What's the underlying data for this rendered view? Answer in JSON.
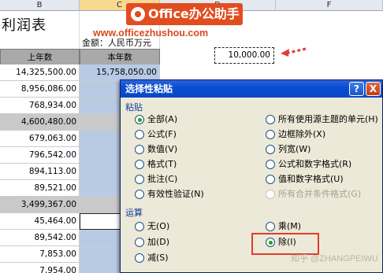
{
  "columns": [
    {
      "label": "B",
      "selected": false
    },
    {
      "label": "C",
      "selected": true
    },
    {
      "label": "D",
      "selected": false
    },
    {
      "label": "F",
      "selected": false
    }
  ],
  "sheet": {
    "title": "利润表",
    "amount_label": "金额：人民币万元",
    "header_prev": "上年数",
    "header_curr": "本年数",
    "clipboard_value": "10,000.00",
    "rows": [
      {
        "prev": "14,325,500.00",
        "curr": "15,758,050.00",
        "prev_style": "white",
        "curr_style": "blue"
      },
      {
        "prev": "8,956,086.00",
        "curr": "9,8",
        "prev_style": "white",
        "curr_style": "blue"
      },
      {
        "prev": "768,934.00",
        "curr": "8",
        "prev_style": "white",
        "curr_style": "blue"
      },
      {
        "prev": "4,600,480.00",
        "curr": "5,0",
        "prev_style": "gray",
        "curr_style": "gray"
      },
      {
        "prev": "679,063.00",
        "curr": "7",
        "prev_style": "white",
        "curr_style": "blue"
      },
      {
        "prev": "796,542.00",
        "curr": "8",
        "prev_style": "white",
        "curr_style": "blue"
      },
      {
        "prev": "894,113.00",
        "curr": "9",
        "prev_style": "white",
        "curr_style": "blue"
      },
      {
        "prev": "89,521.00",
        "curr": "",
        "prev_style": "white",
        "curr_style": "blue"
      },
      {
        "prev": "3,499,367.00",
        "curr": "3,8",
        "prev_style": "gray",
        "curr_style": "gray"
      },
      {
        "prev": "45,464.00",
        "curr": "",
        "prev_style": "white",
        "curr_style": "emptybox"
      },
      {
        "prev": "89,542.00",
        "curr": "",
        "prev_style": "white",
        "curr_style": "blue"
      },
      {
        "prev": "7,853.00",
        "curr": "",
        "prev_style": "white",
        "curr_style": "blue"
      },
      {
        "prev": "7,954.00",
        "curr": "",
        "prev_style": "white",
        "curr_style": "blue"
      }
    ]
  },
  "overlay": {
    "banner": "Office办公助手",
    "url": "www.officezhushou.com"
  },
  "dialog": {
    "title": "选择性粘贴",
    "help_label": "?",
    "close_label": "X",
    "paste_section": "粘贴",
    "paste_left": [
      {
        "label": "全部(A)",
        "checked": true,
        "disabled": false
      },
      {
        "label": "公式(F)",
        "checked": false,
        "disabled": false
      },
      {
        "label": "数值(V)",
        "checked": false,
        "disabled": false
      },
      {
        "label": "格式(T)",
        "checked": false,
        "disabled": false
      },
      {
        "label": "批注(C)",
        "checked": false,
        "disabled": false
      },
      {
        "label": "有效性验证(N)",
        "checked": false,
        "disabled": false
      }
    ],
    "paste_right": [
      {
        "label": "所有使用源主题的单元(H)",
        "checked": false,
        "disabled": false
      },
      {
        "label": "边框除外(X)",
        "checked": false,
        "disabled": false
      },
      {
        "label": "列宽(W)",
        "checked": false,
        "disabled": false
      },
      {
        "label": "公式和数字格式(R)",
        "checked": false,
        "disabled": false
      },
      {
        "label": "值和数字格式(U)",
        "checked": false,
        "disabled": false
      },
      {
        "label": "所有合并条件格式(G)",
        "checked": false,
        "disabled": true
      }
    ],
    "operation_section": "运算",
    "op_left": [
      {
        "label": "无(O)",
        "checked": false,
        "disabled": false
      },
      {
        "label": "加(D)",
        "checked": false,
        "disabled": false
      },
      {
        "label": "减(S)",
        "checked": false,
        "disabled": false
      }
    ],
    "op_right": [
      {
        "label": "乘(M)",
        "checked": false,
        "disabled": false
      },
      {
        "label": "除(I)",
        "checked": true,
        "disabled": false
      }
    ],
    "watermark": "知乎 @ZHANGPEIWU"
  },
  "colors": {
    "title_bar": "#0a4dd6",
    "dialog_bg": "#ece9d8",
    "highlight": "#e33a2f",
    "banner": "#e24d1f",
    "selected_cell": "#b9cbe4"
  }
}
